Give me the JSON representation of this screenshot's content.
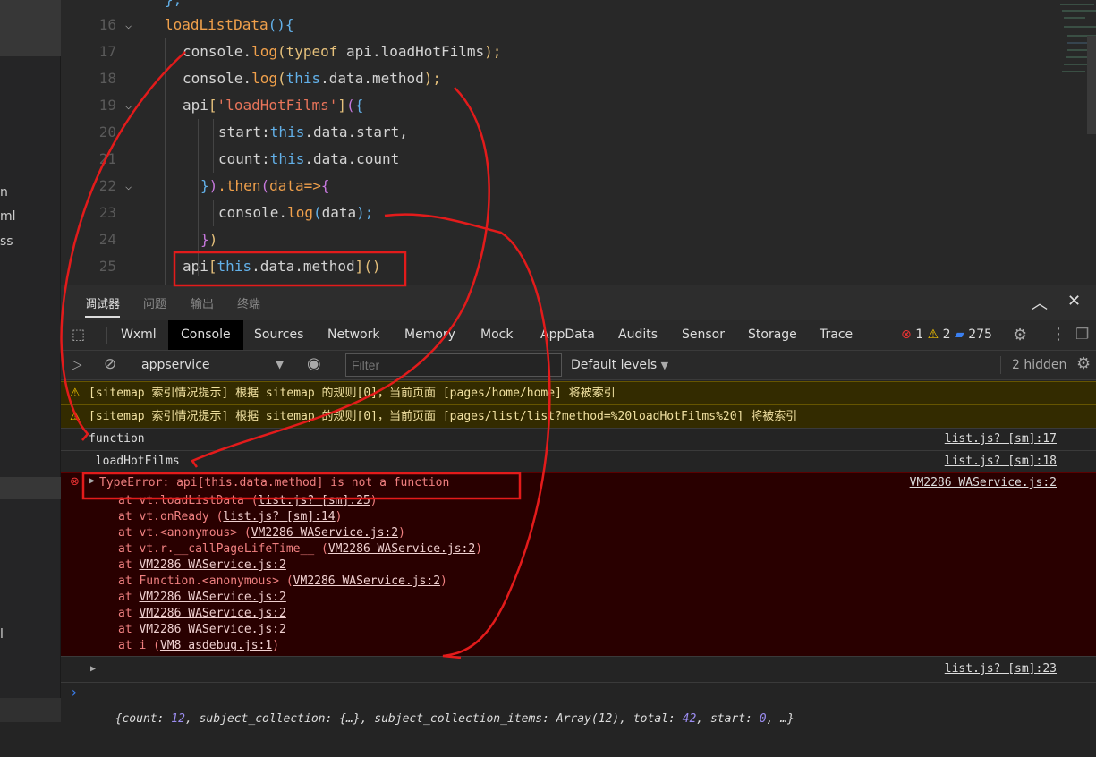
{
  "sidebar": {
    "fragments": [
      "n",
      "ml",
      "ss",
      "l"
    ]
  },
  "editor": {
    "lines": [
      {
        "n": "16",
        "fold": true,
        "indent": 0,
        "tokens": [
          {
            "t": "loadListData",
            "c": "#f0a04b"
          },
          {
            "t": "(){",
            "c": "#62b0e8"
          }
        ]
      },
      {
        "n": "17",
        "fold": false,
        "indent": 1,
        "tokens": [
          {
            "t": "console.",
            "c": "#d4d4d4"
          },
          {
            "t": "log",
            "c": "#f0a04b"
          },
          {
            "t": "(",
            "c": "#e5c07b"
          },
          {
            "t": "typeof",
            "c": "#e5c07b"
          },
          {
            "t": " api.loadHotFilms",
            "c": "#d4d4d4"
          },
          {
            "t": ");",
            "c": "#e5c07b"
          }
        ]
      },
      {
        "n": "18",
        "fold": false,
        "indent": 1,
        "tokens": [
          {
            "t": "console.",
            "c": "#d4d4d4"
          },
          {
            "t": "log",
            "c": "#f0a04b"
          },
          {
            "t": "(",
            "c": "#e5c07b"
          },
          {
            "t": "this",
            "c": "#62b0e8"
          },
          {
            "t": ".data.method",
            "c": "#d4d4d4"
          },
          {
            "t": ");",
            "c": "#e5c07b"
          }
        ]
      },
      {
        "n": "19",
        "fold": true,
        "indent": 1,
        "tokens": [
          {
            "t": "api",
            "c": "#d4d4d4"
          },
          {
            "t": "[",
            "c": "#e5c07b"
          },
          {
            "t": "'loadHotFilms'",
            "c": "#e8745a"
          },
          {
            "t": "]",
            "c": "#e5c07b"
          },
          {
            "t": "(",
            "c": "#c678dd"
          },
          {
            "t": "{",
            "c": "#62b0e8"
          }
        ]
      },
      {
        "n": "20",
        "fold": false,
        "indent": 3,
        "tokens": [
          {
            "t": "start:",
            "c": "#d4d4d4"
          },
          {
            "t": "this",
            "c": "#62b0e8"
          },
          {
            "t": ".data.start,",
            "c": "#d4d4d4"
          }
        ]
      },
      {
        "n": "21",
        "fold": false,
        "indent": 3,
        "tokens": [
          {
            "t": "count:",
            "c": "#d4d4d4"
          },
          {
            "t": "this",
            "c": "#62b0e8"
          },
          {
            "t": ".data.count",
            "c": "#d4d4d4"
          }
        ]
      },
      {
        "n": "22",
        "fold": true,
        "indent": 2,
        "tokens": [
          {
            "t": "}",
            "c": "#62b0e8"
          },
          {
            "t": ")",
            "c": "#c678dd"
          },
          {
            "t": ".then",
            "c": "#f0a04b"
          },
          {
            "t": "(",
            "c": "#c678dd"
          },
          {
            "t": "data=>",
            "c": "#f0a04b"
          },
          {
            "t": "{",
            "c": "#c678dd"
          }
        ]
      },
      {
        "n": "23",
        "fold": false,
        "indent": 3,
        "tokens": [
          {
            "t": "console.",
            "c": "#d4d4d4"
          },
          {
            "t": "log",
            "c": "#f0a04b"
          },
          {
            "t": "(",
            "c": "#62b0e8"
          },
          {
            "t": "data",
            "c": "#d4d4d4"
          },
          {
            "t": ");",
            "c": "#62b0e8"
          }
        ]
      },
      {
        "n": "24",
        "fold": false,
        "indent": 2,
        "tokens": [
          {
            "t": "}",
            "c": "#c678dd"
          },
          {
            "t": ")",
            "c": "#e5c07b"
          }
        ]
      },
      {
        "n": "25",
        "fold": false,
        "indent": 1,
        "tokens": [
          {
            "t": "api",
            "c": "#d4d4d4"
          },
          {
            "t": "[",
            "c": "#e5c07b"
          },
          {
            "t": "this",
            "c": "#62b0e8"
          },
          {
            "t": ".data.method",
            "c": "#d4d4d4"
          },
          {
            "t": "]",
            "c": "#e5c07b"
          },
          {
            "t": "()",
            "c": "#e5c07b"
          }
        ]
      }
    ]
  },
  "panel": {
    "tabs": [
      "调试器",
      "问题",
      "输出",
      "终端"
    ],
    "active_tab": "调试器"
  },
  "devtools": {
    "tabs": [
      "Wxml",
      "Console",
      "Sources",
      "Network",
      "Memory",
      "Mock",
      "AppData",
      "Audits",
      "Sensor",
      "Storage",
      "Trace"
    ],
    "active_tab": "Console",
    "counts": {
      "errors": "1",
      "warnings": "2",
      "messages": "275"
    },
    "context": "appservice",
    "filter_placeholder": "Filter",
    "levels": "Default levels",
    "hidden": "2 hidden"
  },
  "console": {
    "warnings": [
      "[sitemap 索引情况提示] 根据 sitemap 的规则[0]，当前页面 [pages/home/home] 将被索引",
      "[sitemap 索引情况提示] 根据 sitemap 的规则[0]，当前页面 [pages/list/list?method=%20loadHotFilms%20] 将被索引"
    ],
    "logs": [
      {
        "text": "function",
        "source": "list.js? [sm]:17"
      },
      {
        "text": " loadHotFilms",
        "source": "list.js? [sm]:18"
      }
    ],
    "error": {
      "message": "TypeError: api[this.data.method] is not a function",
      "source": "VM2286 WAService.js:2",
      "stack": [
        {
          "pre": "at vt.loadListData (",
          "link": "list.js? [sm]:25",
          "post": ")"
        },
        {
          "pre": "at vt.onReady (",
          "link": "list.js? [sm]:14",
          "post": ")"
        },
        {
          "pre": "at vt.<anonymous> (",
          "link": "VM2286 WAService.js:2",
          "post": ")"
        },
        {
          "pre": "at vt.r.__callPageLifeTime__ (",
          "link": "VM2286 WAService.js:2",
          "post": ")"
        },
        {
          "pre": "at ",
          "link": "VM2286 WAService.js:2",
          "post": ""
        },
        {
          "pre": "at Function.<anonymous> (",
          "link": "VM2286 WAService.js:2",
          "post": ")"
        },
        {
          "pre": "at ",
          "link": "VM2286 WAService.js:2",
          "post": ""
        },
        {
          "pre": "at ",
          "link": "VM2286 WAService.js:2",
          "post": ""
        },
        {
          "pre": "at ",
          "link": "VM2286 WAService.js:2",
          "post": ""
        },
        {
          "pre": "at i (",
          "link": "VM8 asdebug.js:1",
          "post": ")"
        }
      ]
    },
    "object": {
      "text": "{count: 12, subject_collection: {…}, subject_collection_items: Array(12), total: 42, start: 0, …}",
      "source": "list.js? [sm]:23"
    },
    "prompt": "›"
  }
}
